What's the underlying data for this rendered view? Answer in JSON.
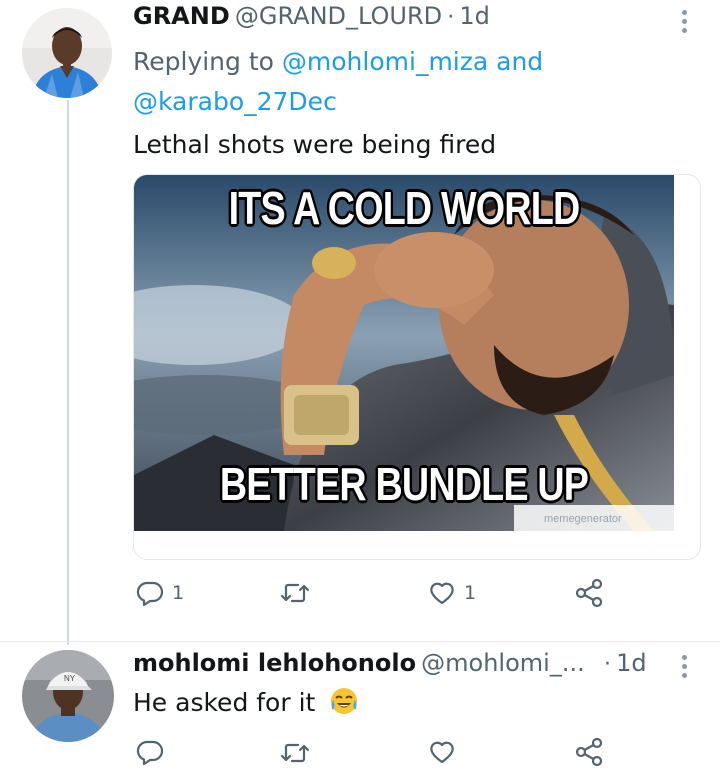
{
  "tweet1": {
    "display_name": "GRAND",
    "handle": "@GRAND_LOURD",
    "separator": "·",
    "time": "1d",
    "replying_prefix": "Replying to",
    "mention_1": "@mohlomi_miza",
    "and_text": "and",
    "mention_2": "@karabo_27Dec",
    "text": "Lethal shots were being fired",
    "meme": {
      "top_text": "ITS A COLD WORLD",
      "bottom_text": "BETTER BUNDLE UP",
      "watermark": "memegenerator"
    },
    "actions": {
      "reply_count": "1",
      "retweet_count": "",
      "like_count": "1"
    }
  },
  "tweet2": {
    "display_name": "mohlomi lehlohonolo",
    "handle": "@mohlomi_...",
    "separator": "·",
    "time": "1d",
    "text": "He asked for it",
    "emoji": "😂",
    "actions": {
      "reply_count": "",
      "retweet_count": "",
      "like_count": ""
    }
  },
  "colors": {
    "text": "#14171a",
    "secondary": "#536471",
    "link": "#1d9bf0",
    "thread_line": "#cfd9de"
  },
  "icons": [
    "more-icon",
    "reply-icon",
    "retweet-icon",
    "like-icon",
    "share-icon"
  ]
}
